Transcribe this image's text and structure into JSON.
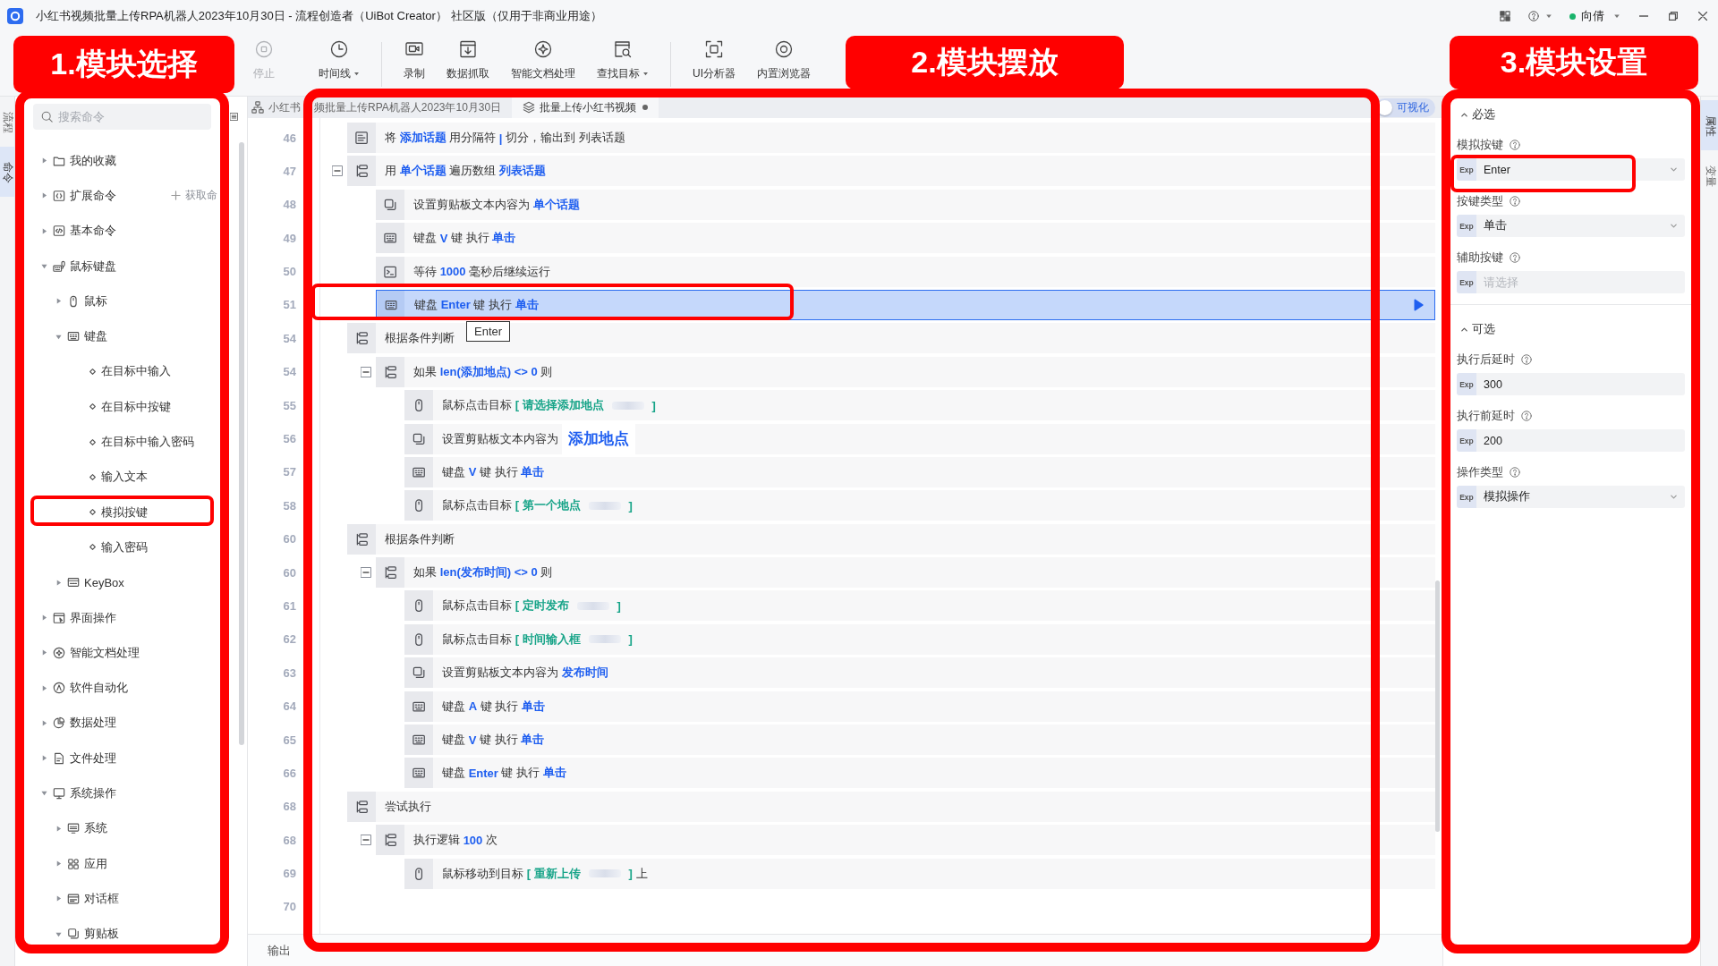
{
  "window": {
    "title": "小红书视频批量上传RPA机器人2023年10月30日 - 流程创造者（UiBot Creator） 社区版（仅用于非商业用途）",
    "user": "向倩"
  },
  "toolbar": {
    "groups": [
      [
        {
          "label": "停止",
          "kind": "stop",
          "disabled": true,
          "dropdown": false
        },
        {
          "label": "时间线",
          "kind": "timeline",
          "disabled": false,
          "dropdown": true
        }
      ],
      [
        {
          "label": "录制",
          "kind": "record",
          "disabled": false,
          "dropdown": false
        },
        {
          "label": "数据抓取",
          "kind": "capture",
          "disabled": false,
          "dropdown": false
        },
        {
          "label": "智能文档处理",
          "kind": "document",
          "disabled": false,
          "dropdown": false
        },
        {
          "label": "查找目标",
          "kind": "find",
          "disabled": false,
          "dropdown": true
        }
      ],
      [
        {
          "label": "UI分析器",
          "kind": "analyzer",
          "disabled": false,
          "dropdown": false
        },
        {
          "label": "内置浏览器",
          "kind": "browser",
          "disabled": false,
          "dropdown": false
        }
      ]
    ]
  },
  "left_tabs": [
    {
      "label": "流程",
      "selected": false
    },
    {
      "label": "命令",
      "selected": true
    }
  ],
  "commands": {
    "search": {
      "placeholder": "搜索命令"
    },
    "items": [
      {
        "label": "我的收藏",
        "kind": "favorites",
        "expanded": false,
        "annotated": false
      },
      {
        "label": "扩展命令",
        "kind": "extensions",
        "expanded": false,
        "annotated": false,
        "action": "获取命"
      },
      {
        "label": "基本命令",
        "kind": "basic",
        "expanded": false,
        "annotated": false
      },
      {
        "label": "鼠标键盘",
        "kind": "input",
        "expanded": true,
        "annotated": false,
        "children": [
          {
            "label": "鼠标",
            "kind": "mouse",
            "expanded": false,
            "annotated": false
          },
          {
            "label": "键盘",
            "kind": "keyboard",
            "expanded": true,
            "annotated": false,
            "children": [
              {
                "label": "在目标中输入",
                "kind": "command",
                "annotated": false
              },
              {
                "label": "在目标中按键",
                "kind": "command",
                "annotated": false
              },
              {
                "label": "在目标中输入密码",
                "kind": "command",
                "annotated": false
              },
              {
                "label": "输入文本",
                "kind": "command",
                "annotated": false
              },
              {
                "label": "模拟按键",
                "kind": "command",
                "annotated": true
              },
              {
                "label": "输入密码",
                "kind": "command",
                "annotated": false
              }
            ]
          },
          {
            "label": "KeyBox",
            "kind": "keybox",
            "expanded": false,
            "annotated": false
          }
        ]
      },
      {
        "label": "界面操作",
        "kind": "ui",
        "expanded": false,
        "annotated": false
      },
      {
        "label": "智能文档处理",
        "kind": "document",
        "expanded": false,
        "annotated": false
      },
      {
        "label": "软件自动化",
        "kind": "automation",
        "expanded": false,
        "annotated": false
      },
      {
        "label": "数据处理",
        "kind": "data",
        "expanded": false,
        "annotated": false
      },
      {
        "label": "文件处理",
        "kind": "file",
        "expanded": false,
        "annotated": false
      },
      {
        "label": "系统操作",
        "kind": "system",
        "expanded": true,
        "annotated": false,
        "children": [
          {
            "label": "系统",
            "kind": "sys",
            "expanded": false,
            "annotated": false
          },
          {
            "label": "应用",
            "kind": "apps",
            "expanded": false,
            "annotated": false
          },
          {
            "label": "对话框",
            "kind": "dialog",
            "expanded": false,
            "annotated": false
          },
          {
            "label": "剪贴板",
            "kind": "clipboard",
            "expanded": true,
            "annotated": false
          }
        ]
      }
    ]
  },
  "editor": {
    "tabs": [
      {
        "kind": "flow",
        "title_parts": [
          "小红书",
          "频批量上传RPA机器人2023年10月30日"
        ],
        "selected": false,
        "modified": false
      },
      {
        "kind": "block",
        "title_parts": [
          "批量上传小红书视频"
        ],
        "selected": true,
        "modified": true
      }
    ],
    "visual_toggle": {
      "label": "可视化",
      "on": false
    },
    "rows": [
      {
        "line": "46",
        "kind": "split",
        "selected": false,
        "annotated": false,
        "parts": [
          {
            "kind": "text",
            "text": "将 "
          },
          {
            "kind": "var",
            "text": "添加话题"
          },
          {
            "kind": "text",
            "text": " 用分隔符 "
          },
          {
            "kind": "var",
            "text": "|"
          },
          {
            "kind": "text",
            "text": " 切分，输出到 列表话题"
          }
        ]
      },
      {
        "line": "47",
        "kind": "loop",
        "selected": false,
        "annotated": false,
        "expanded": true,
        "parts": [
          {
            "kind": "text",
            "text": "用 "
          },
          {
            "kind": "var",
            "text": "单个话题"
          },
          {
            "kind": "text",
            "text": " 遍历数组 "
          },
          {
            "kind": "var",
            "text": "列表话题"
          }
        ],
        "children": [
          {
            "line": "48",
            "kind": "clipboard",
            "selected": false,
            "annotated": false,
            "parts": [
              {
                "kind": "text",
                "text": "设置剪贴板文本内容为 "
              },
              {
                "kind": "var",
                "text": "单个话题"
              }
            ]
          },
          {
            "line": "49",
            "kind": "keyboard",
            "selected": false,
            "annotated": false,
            "parts": [
              {
                "kind": "text",
                "text": "键盘 "
              },
              {
                "kind": "var",
                "text": "V"
              },
              {
                "kind": "text",
                "text": " 键 执行 "
              },
              {
                "kind": "var",
                "text": "单击"
              }
            ]
          },
          {
            "line": "50",
            "kind": "wait",
            "selected": false,
            "annotated": false,
            "parts": [
              {
                "kind": "text",
                "text": "等待 "
              },
              {
                "kind": "var",
                "text": "1000"
              },
              {
                "kind": "text",
                "text": " 毫秒后继续运行"
              }
            ]
          },
          {
            "line": "51",
            "kind": "keyboard",
            "selected": true,
            "annotated": true,
            "parts": [
              {
                "kind": "text",
                "text": "键盘 "
              },
              {
                "kind": "var",
                "text": "Enter"
              },
              {
                "kind": "text",
                "text": " 键 执行 "
              },
              {
                "kind": "var",
                "text": "单击"
              }
            ]
          }
        ]
      },
      {
        "line": "54",
        "kind": "condition",
        "selected": false,
        "annotated": false,
        "parts": [
          {
            "kind": "text",
            "text": "根据条件判断"
          }
        ],
        "children": [
          {
            "line": "54",
            "kind": "branch",
            "selected": false,
            "annotated": false,
            "expanded": true,
            "parts": [
              {
                "kind": "text",
                "text": "如果 "
              },
              {
                "kind": "var",
                "text": "len(添加地点) <> 0"
              },
              {
                "kind": "text",
                "text": " 则"
              }
            ],
            "children": [
              {
                "line": "55",
                "kind": "mouse",
                "selected": false,
                "annotated": false,
                "parts": [
                  {
                    "kind": "text",
                    "text": "鼠标点击目标 "
                  },
                  {
                    "kind": "target",
                    "text": "[ 请选择添加地点"
                  },
                  {
                    "kind": "thumb"
                  },
                  {
                    "kind": "target",
                    "text": "]"
                  }
                ]
              },
              {
                "line": "56",
                "kind": "clipboard",
                "selected": false,
                "annotated": false,
                "parts": [
                  {
                    "kind": "text",
                    "text": "设置剪贴板文本内容为 "
                  },
                  {
                    "kind": "hover",
                    "text": "添加地点"
                  }
                ]
              },
              {
                "line": "57",
                "kind": "keyboard",
                "selected": false,
                "annotated": false,
                "parts": [
                  {
                    "kind": "text",
                    "text": "键盘 "
                  },
                  {
                    "kind": "var",
                    "text": "V"
                  },
                  {
                    "kind": "text",
                    "text": " 键 执行 "
                  },
                  {
                    "kind": "var",
                    "text": "单击"
                  }
                ]
              },
              {
                "line": "58",
                "kind": "mouse",
                "selected": false,
                "annotated": false,
                "parts": [
                  {
                    "kind": "text",
                    "text": "鼠标点击目标 "
                  },
                  {
                    "kind": "target",
                    "text": "[ 第一个地点"
                  },
                  {
                    "kind": "thumb"
                  },
                  {
                    "kind": "target",
                    "text": "]"
                  }
                ]
              }
            ]
          }
        ]
      },
      {
        "line": "60",
        "kind": "condition",
        "selected": false,
        "annotated": false,
        "parts": [
          {
            "kind": "text",
            "text": "根据条件判断"
          }
        ],
        "children": [
          {
            "line": "60",
            "kind": "branch",
            "selected": false,
            "annotated": false,
            "expanded": true,
            "parts": [
              {
                "kind": "text",
                "text": "如果 "
              },
              {
                "kind": "var",
                "text": "len(发布时间) <> 0"
              },
              {
                "kind": "text",
                "text": " 则"
              }
            ],
            "children": [
              {
                "line": "61",
                "kind": "mouse",
                "selected": false,
                "annotated": false,
                "parts": [
                  {
                    "kind": "text",
                    "text": "鼠标点击目标 "
                  },
                  {
                    "kind": "target",
                    "text": "[ 定时发布"
                  },
                  {
                    "kind": "thumb"
                  },
                  {
                    "kind": "target",
                    "text": "]"
                  }
                ]
              },
              {
                "line": "62",
                "kind": "mouse",
                "selected": false,
                "annotated": false,
                "parts": [
                  {
                    "kind": "text",
                    "text": "鼠标点击目标 "
                  },
                  {
                    "kind": "target",
                    "text": "[ 时间输入框"
                  },
                  {
                    "kind": "thumb"
                  },
                  {
                    "kind": "target",
                    "text": "]"
                  }
                ]
              },
              {
                "line": "63",
                "kind": "clipboard",
                "selected": false,
                "annotated": false,
                "parts": [
                  {
                    "kind": "text",
                    "text": "设置剪贴板文本内容为 "
                  },
                  {
                    "kind": "var",
                    "text": "发布时间"
                  }
                ]
              },
              {
                "line": "64",
                "kind": "keyboard",
                "selected": false,
                "annotated": false,
                "parts": [
                  {
                    "kind": "text",
                    "text": "键盘 "
                  },
                  {
                    "kind": "var",
                    "text": "A"
                  },
                  {
                    "kind": "text",
                    "text": " 键 执行 "
                  },
                  {
                    "kind": "var",
                    "text": "单击"
                  }
                ]
              },
              {
                "line": "65",
                "kind": "keyboard",
                "selected": false,
                "annotated": false,
                "parts": [
                  {
                    "kind": "text",
                    "text": "键盘 "
                  },
                  {
                    "kind": "var",
                    "text": "V"
                  },
                  {
                    "kind": "text",
                    "text": " 键 执行 "
                  },
                  {
                    "kind": "var",
                    "text": "单击"
                  }
                ]
              },
              {
                "line": "66",
                "kind": "keyboard",
                "selected": false,
                "annotated": false,
                "parts": [
                  {
                    "kind": "text",
                    "text": "键盘 "
                  },
                  {
                    "kind": "var",
                    "text": "Enter"
                  },
                  {
                    "kind": "text",
                    "text": " 键 执行 "
                  },
                  {
                    "kind": "var",
                    "text": "单击"
                  }
                ]
              }
            ]
          }
        ]
      },
      {
        "line": "68",
        "kind": "try",
        "selected": false,
        "annotated": false,
        "parts": [
          {
            "kind": "text",
            "text": "尝试执行"
          }
        ],
        "children": [
          {
            "line": "68",
            "kind": "repeat",
            "selected": false,
            "annotated": false,
            "expanded": true,
            "parts": [
              {
                "kind": "text",
                "text": "执行逻辑 "
              },
              {
                "kind": "var",
                "text": "100"
              },
              {
                "kind": "text",
                "text": " 次"
              }
            ],
            "children": [
              {
                "line": "69",
                "kind": "mouse",
                "selected": false,
                "annotated": false,
                "parts": [
                  {
                    "kind": "text",
                    "text": "鼠标移动到目标 "
                  },
                  {
                    "kind": "target",
                    "text": "[ 重新上传"
                  },
                  {
                    "kind": "thumb"
                  },
                  {
                    "kind": "target",
                    "text": "]"
                  },
                  {
                    "kind": "text",
                    "text": " 上"
                  }
                ]
              }
            ]
          }
        ]
      }
    ],
    "trailing_lines": [
      "70"
    ],
    "tooltip": {
      "text": "Enter"
    },
    "output": {
      "label": "输出"
    }
  },
  "properties": {
    "sections": [
      {
        "title": "必选",
        "expanded": true,
        "fields": [
          {
            "label": "模拟按键",
            "kind": "select",
            "mode": "Exp",
            "value": "Enter",
            "annotated": true
          },
          {
            "label": "按键类型",
            "kind": "select",
            "mode": "Exp",
            "value": "单击",
            "annotated": false
          },
          {
            "label": "辅助按键",
            "kind": "input",
            "mode": "Exp",
            "placeholder": "请选择",
            "annotated": false
          }
        ]
      },
      {
        "title": "可选",
        "expanded": true,
        "fields": [
          {
            "label": "执行后延时",
            "kind": "input",
            "mode": "Exp",
            "value": "300",
            "annotated": false
          },
          {
            "label": "执行前延时",
            "kind": "input",
            "mode": "Exp",
            "value": "200",
            "annotated": false
          },
          {
            "label": "操作类型",
            "kind": "select",
            "mode": "Exp",
            "value": "模拟操作",
            "annotated": false
          }
        ]
      }
    ]
  },
  "right_tabs": [
    {
      "label": "属性",
      "selected": true
    },
    {
      "label": "变量",
      "selected": false
    }
  ],
  "annotations": [
    {
      "label": "1.模块选择"
    },
    {
      "label": "2.模块摆放"
    },
    {
      "label": "3.模块设置"
    }
  ]
}
